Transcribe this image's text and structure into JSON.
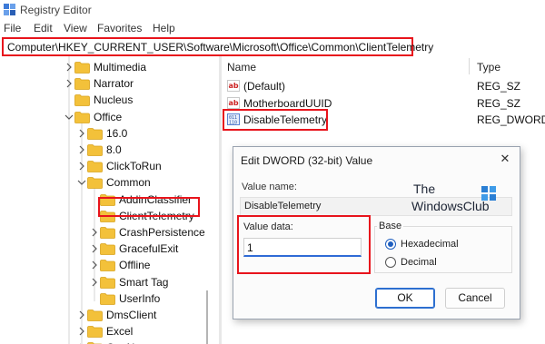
{
  "window": {
    "title": "Registry Editor"
  },
  "menu": [
    "File",
    "Edit",
    "View",
    "Favorites",
    "Help"
  ],
  "address": "Computer\\HKEY_CURRENT_USER\\Software\\Microsoft\\Office\\Common\\ClientTelemetry",
  "tree": {
    "items": [
      {
        "label": "Multimedia",
        "expand": "collapsed"
      },
      {
        "label": "Narrator",
        "expand": "collapsed"
      },
      {
        "label": "Nucleus",
        "expand": "none"
      },
      {
        "label": "Office",
        "expand": "expanded"
      },
      {
        "label": "16.0",
        "expand": "collapsed"
      },
      {
        "label": "8.0",
        "expand": "collapsed"
      },
      {
        "label": "ClickToRun",
        "expand": "collapsed"
      },
      {
        "label": "Common",
        "expand": "expanded"
      },
      {
        "label": "AddinClassifier",
        "expand": "none"
      },
      {
        "label": "ClientTelemetry",
        "expand": "none",
        "selected": true
      },
      {
        "label": "CrashPersistence",
        "expand": "collapsed"
      },
      {
        "label": "GracefulExit",
        "expand": "collapsed"
      },
      {
        "label": "Offline",
        "expand": "collapsed"
      },
      {
        "label": "Smart Tag",
        "expand": "collapsed"
      },
      {
        "label": "UserInfo",
        "expand": "none"
      },
      {
        "label": "DmsClient",
        "expand": "collapsed"
      },
      {
        "label": "Excel",
        "expand": "collapsed"
      },
      {
        "label": "OneNote",
        "expand": "collapsed"
      }
    ]
  },
  "values": {
    "headers": {
      "name": "Name",
      "type": "Type"
    },
    "rows": [
      {
        "name": "(Default)",
        "type": "REG_SZ",
        "icon": "string-value-icon"
      },
      {
        "name": "MotherboardUUID",
        "type": "REG_SZ",
        "icon": "string-value-icon"
      },
      {
        "name": "DisableTelemetry",
        "type": "REG_DWORD",
        "icon": "binary-value-icon"
      }
    ]
  },
  "dialog": {
    "title": "Edit DWORD (32-bit) Value",
    "close": "✕",
    "value_name_label": "Value name:",
    "value_name": "DisableTelemetry",
    "value_data_label": "Value data:",
    "value_data": "1",
    "base_label": "Base",
    "base_options": [
      "Hexadecimal",
      "Decimal"
    ],
    "base_selected": "Hexadecimal",
    "ok": "OK",
    "cancel": "Cancel"
  },
  "watermark": {
    "line1": "The",
    "line2": "WindowsClub"
  },
  "colors": {
    "highlight": "#e8141c",
    "folder": "#f3c13a",
    "accent": "#1f5fbf"
  }
}
